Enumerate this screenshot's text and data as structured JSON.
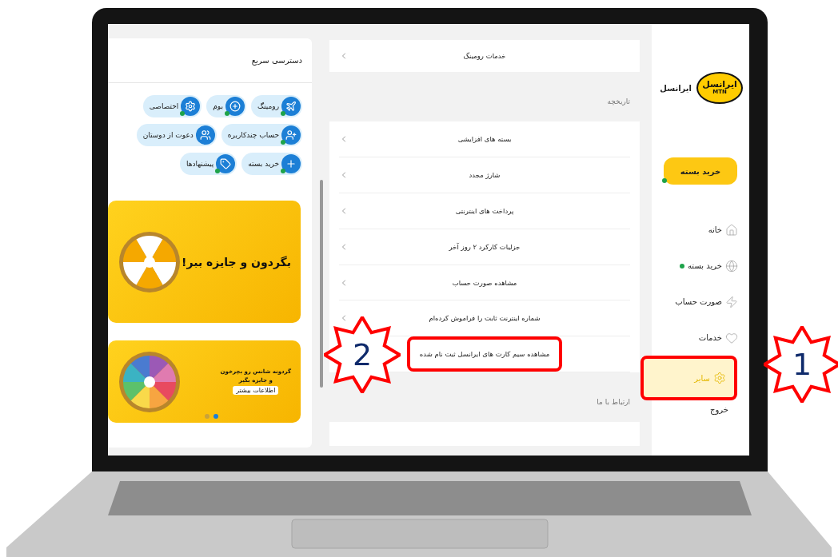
{
  "quick_access": {
    "title": "دسترسی سریع",
    "rows": [
      [
        {
          "label": "رومینگ",
          "kind": "plane",
          "badge": true
        },
        {
          "label": "بوم",
          "kind": "plus-gear",
          "badge": true
        },
        {
          "label": "اختصاصی",
          "kind": "gear",
          "badge": true
        }
      ],
      [
        {
          "label": "حساب چندکاربره",
          "kind": "user-plus",
          "badge": true
        },
        {
          "label": "دعوت از دوستان",
          "kind": "users",
          "badge": false
        }
      ],
      [
        {
          "label": "خرید بسته",
          "kind": "plus",
          "badge": true
        },
        {
          "label": "پیشنهادها",
          "kind": "tag",
          "badge": true
        }
      ]
    ],
    "banners": [
      {
        "kind": "wheel",
        "headline": "بگردون و جایزه ببر!"
      },
      {
        "kind": "color-wheel",
        "headline": "گردونه شانس رو بچرخون",
        "subline": "و جایزه بگیر",
        "button": "اطلاعات بیشتر",
        "dots": [
          {
            "selected": true
          },
          {
            "selected": false
          }
        ]
      }
    ]
  },
  "menu": {
    "sections": [
      {
        "items": [
          {
            "label": "خدمات رومینگ",
            "highlighted": false
          }
        ]
      },
      {
        "title": "تاریخچه",
        "items": [
          {
            "label": "بسته های افزایشی",
            "highlighted": false
          },
          {
            "label": "شارژ مجدد",
            "highlighted": false
          },
          {
            "label": "پرداخت های اینترنتی",
            "highlighted": false
          },
          {
            "label": "جزلیات کارکرد ۲ روز آخر",
            "highlighted": false
          },
          {
            "label": "مشاهده صورت حساب",
            "highlighted": false
          },
          {
            "label": "شماره اینترنت ثابت را فراموش کرده‌ام",
            "highlighted": false
          },
          {
            "label": "مشاهده سیم کارت های ایرانسل ثبت نام شده",
            "highlighted": true
          }
        ]
      },
      {
        "title": "ارتباط با ما"
      }
    ]
  },
  "sidebar": {
    "logo": {
      "text": "ایرانسل",
      "subtext": "MTN"
    },
    "brand": "ایرانسل",
    "cta": {
      "label": "خرید بسته",
      "badge": true
    },
    "items": [
      {
        "label": "خانه",
        "kind": "home",
        "selected": false,
        "badge": false,
        "highlighted": false
      },
      {
        "label": "خرید بسته",
        "kind": "globe",
        "selected": false,
        "badge": true,
        "highlighted": false
      },
      {
        "label": "صورت حساب",
        "kind": "bolt",
        "selected": false,
        "badge": false,
        "highlighted": false
      },
      {
        "label": "خدمات",
        "kind": "heart",
        "selected": false,
        "badge": false,
        "highlighted": false
      },
      {
        "label": "سایر",
        "kind": "gear",
        "selected": true,
        "badge": false,
        "highlighted": true
      }
    ],
    "logout": "خروج"
  },
  "callouts": [
    {
      "number": "1"
    },
    {
      "number": "2"
    }
  ]
}
